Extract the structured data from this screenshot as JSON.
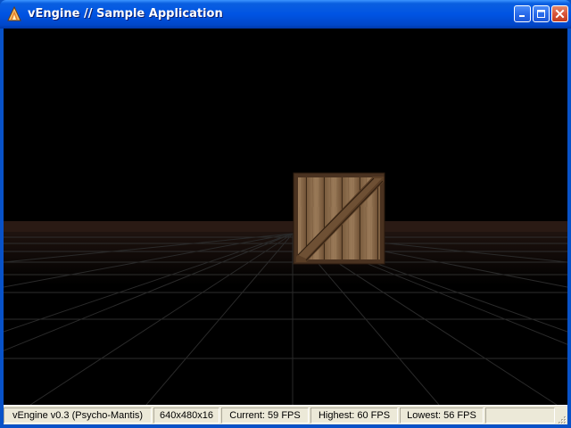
{
  "window": {
    "title": "vEngine // Sample Application",
    "title_icon": "flame-app-icon",
    "buttons": {
      "minimize": "minimize-icon",
      "maximize": "maximize-icon",
      "close": "close-icon"
    }
  },
  "scene": {
    "objects": [
      "wooden-crate",
      "floor-grid"
    ],
    "colors": {
      "background": "#000000",
      "floor": "#241612",
      "grid_line": "#3A3A3A",
      "crate_wood": "#8B6A48",
      "crate_frame": "#4A3220"
    }
  },
  "statusbar": {
    "version": "vEngine v0.3 (Psycho-Mantis)",
    "resolution": "640x480x16",
    "current_fps": "Current: 59 FPS",
    "highest_fps": "Highest: 60 FPS",
    "lowest_fps": "Lowest: 56 FPS"
  },
  "colors": {
    "titlebar": "#0054E3",
    "statusbar": "#ECE9D8"
  }
}
